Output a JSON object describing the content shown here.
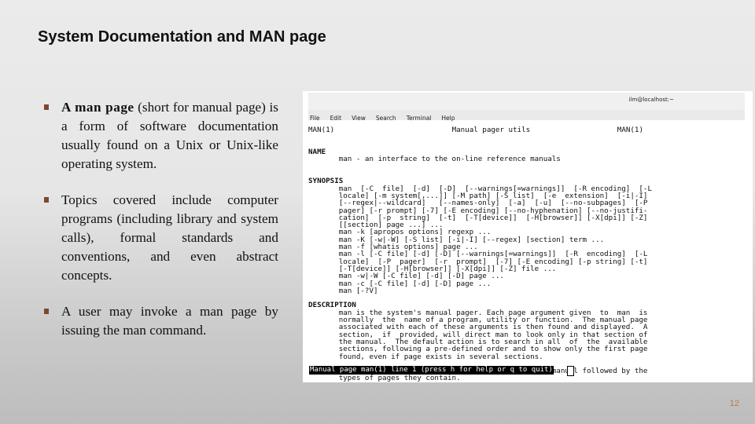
{
  "slide": {
    "title": "System Documentation and MAN page",
    "page_number": "12",
    "bullet_icon": "square-bullet-icon",
    "bullet_color": "#7a4a2e",
    "bullets": [
      {
        "bold": "A man page",
        "text": " (short for manual page) is a form of software documentation usually found on a Unix or Unix-like operating system."
      },
      {
        "bold": "",
        "text": "Topics covered include computer programs (including library and system calls), formal standards and conventions, and even abstract concepts."
      },
      {
        "bold": "",
        "text": "A user may invoke a man page by issuing the man command."
      }
    ]
  },
  "terminal": {
    "window_title": "ilm@localhost:~",
    "menu": [
      "File",
      "Edit",
      "View",
      "Search",
      "Terminal",
      "Help"
    ],
    "header_left": "MAN(1)",
    "header_center": "Manual pager utils",
    "header_right": "MAN(1)",
    "sections": {
      "name_heading": "NAME",
      "name_text": "man - an interface to the on-line reference manuals",
      "synopsis_heading": "SYNOPSIS",
      "synopsis_lines": [
        "man  [-C  file]  [-d]  [-D]  [--warnings[=warnings]]  [-R encoding]  [-L",
        "locale] [-m system[,...]] [-M path] [-S list]  [-e  extension]  [-i|-I]",
        "[--regex|--wildcard]   [--names-only]  [-a]  [-u]  [--no-subpages]  [-P",
        "pager] [-r prompt] [-7] [-E encoding] [--no-hyphenation] [--no-justifi-",
        "cation]  [-p  string]  [-t]  [-T[device]]  [-H[browser]] [-X[dpi]] [-Z]",
        "[[section] page ...] ...",
        "man -k [apropos options] regexp ...",
        "man -K [-w|-W] [-S list] [-i|-I] [--regex] [section] term ...",
        "man -f [whatis options] page ...",
        "man -l [-C file] [-d] [-D] [--warnings[=warnings]]  [-R  encoding]  [-L",
        "locale]  [-P  pager]  [-r  prompt]  [-7] [-E encoding] [-p string] [-t]",
        "[-T[device]] [-H[browser]] [-X[dpi]] [-Z] file ...",
        "man -w|-W [-C file] [-d] [-D] page ...",
        "man -c [-C file] [-d] [-D] page ...",
        "man [-?V]"
      ],
      "description_heading": "DESCRIPTION",
      "description_lines": [
        "man is the system's manual pager. Each page argument given  to  man  is",
        "normally  the  name of a program, utility or function.  The manual page",
        "associated with each of these arguments is then found and displayed.  A",
        "section,  if  provided, will direct man to look only in that section of",
        "the manual.  The default action is to search in all  of  the  available",
        "sections, following a pre-defined order and to show only the first page",
        "found, even if page exists in several sections.",
        "",
        "The table below shows the section numbers of the manual followed by the",
        "types of pages they contain."
      ]
    },
    "status_line": "Manual page man(1) line 1 (press h for help or q to quit)"
  }
}
